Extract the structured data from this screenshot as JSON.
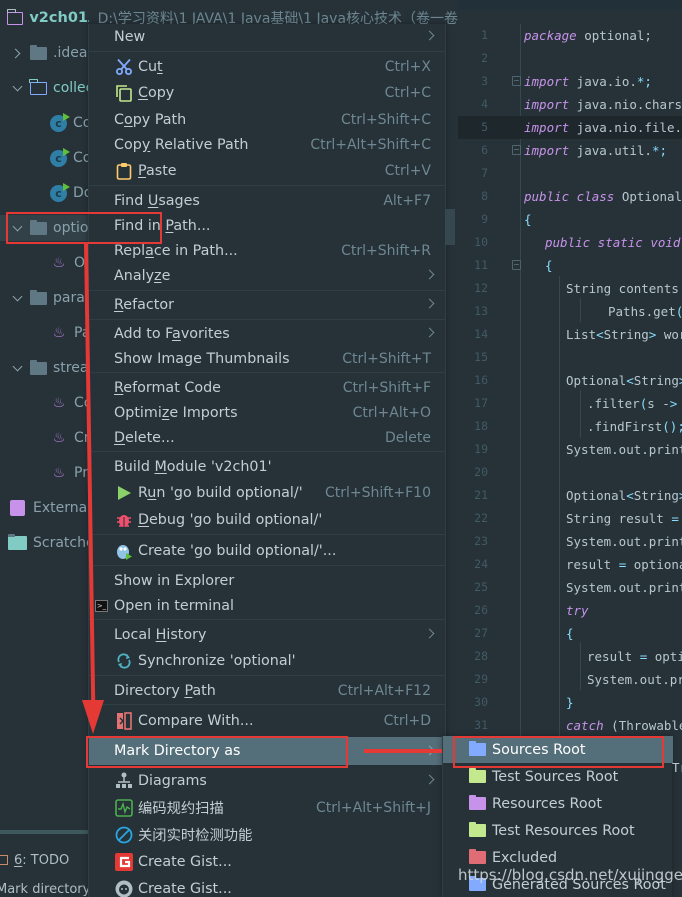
{
  "header": {
    "project_name": "v2ch01",
    "project_path": "D:\\学习资料\\1 JAVA\\1 Java基础\\1 Java核心技术（卷一卷"
  },
  "tree": {
    "items": [
      {
        "label": ".idea",
        "type": "folder",
        "expanded": false
      },
      {
        "label": "collec",
        "type": "folder-outline",
        "expanded": true
      },
      {
        "label": "Co",
        "type": "class"
      },
      {
        "label": "Co",
        "type": "class"
      },
      {
        "label": "Do",
        "type": "class"
      },
      {
        "label": "optio",
        "type": "folder",
        "expanded": true,
        "selected": true
      },
      {
        "label": "Op",
        "type": "java"
      },
      {
        "label": "paral",
        "type": "folder",
        "expanded": true
      },
      {
        "label": "Pa",
        "type": "java"
      },
      {
        "label": "strea",
        "type": "folder",
        "expanded": true
      },
      {
        "label": "Co",
        "type": "java"
      },
      {
        "label": "Cr",
        "type": "java"
      },
      {
        "label": "Pr",
        "type": "java"
      },
      {
        "label": "External",
        "type": "external-libraries"
      },
      {
        "label": "Scratche",
        "type": "scratches"
      }
    ],
    "todo_label_prefix": "6",
    "todo_label": ": TODO",
    "status_tip": "Mark directory"
  },
  "menu": {
    "items": [
      {
        "label": "New",
        "submenu": true
      },
      {
        "label": "Cut",
        "shortcut": "Ctrl+X",
        "icon": "scissors-icon"
      },
      {
        "label": "Copy",
        "shortcut": "Ctrl+C",
        "icon": "copy-icon"
      },
      {
        "label": "Copy Path",
        "shortcut": "Ctrl+Shift+C"
      },
      {
        "label": "Copy Relative Path",
        "shortcut": "Ctrl+Alt+Shift+C"
      },
      {
        "label": "Paste",
        "shortcut": "Ctrl+V",
        "icon": "clipboard-icon"
      },
      {
        "label": "Find Usages",
        "shortcut": "Alt+F7"
      },
      {
        "label": "Find in Path...",
        "shortcut": ""
      },
      {
        "label": "Replace in Path...",
        "shortcut": "Ctrl+Shift+R"
      },
      {
        "label": "Analyze",
        "submenu": true
      },
      {
        "label": "Refactor",
        "submenu": true
      },
      {
        "label": "Add to Favorites",
        "submenu": true
      },
      {
        "label": "Show Image Thumbnails",
        "shortcut": "Ctrl+Shift+T"
      },
      {
        "label": "Reformat Code",
        "shortcut": "Ctrl+Shift+F"
      },
      {
        "label": "Optimize Imports",
        "shortcut": "Ctrl+Alt+O"
      },
      {
        "label": "Delete...",
        "shortcut": "Delete"
      },
      {
        "label": "Build Module 'v2ch01'",
        "shortcut": ""
      },
      {
        "label": "Run 'go build optional/'",
        "shortcut": "Ctrl+Shift+F10",
        "icon": "run-icon"
      },
      {
        "label": "Debug 'go build optional/'",
        "shortcut": "",
        "icon": "debug-icon"
      },
      {
        "label": "Create 'go build optional/'...",
        "shortcut": "",
        "icon": "gopher-icon"
      },
      {
        "label": "Show in Explorer",
        "shortcut": ""
      },
      {
        "label": "Open in terminal",
        "shortcut": "",
        "icon": "terminal-icon"
      },
      {
        "label": "Local History",
        "submenu": true
      },
      {
        "label": "Synchronize 'optional'",
        "shortcut": "",
        "icon": "sync-icon"
      },
      {
        "label": "Directory Path",
        "shortcut": "Ctrl+Alt+F12"
      },
      {
        "label": "Compare With...",
        "shortcut": "Ctrl+D",
        "icon": "compare-icon"
      },
      {
        "label": "Mark Directory as",
        "submenu": true,
        "highlighted": true
      },
      {
        "label": "Diagrams",
        "submenu": true,
        "icon": "diagram-icon"
      },
      {
        "label": "编码规约扫描",
        "shortcut": "Ctrl+Alt+Shift+J",
        "icon": "scan-icon"
      },
      {
        "label": "关闭实时检测功能",
        "shortcut": "",
        "icon": "disable-icon"
      },
      {
        "label": "Create Gist...",
        "shortcut": "",
        "icon": "gitee-icon"
      },
      {
        "label": "Create Gist...",
        "shortcut": "",
        "icon": "github-icon"
      }
    ]
  },
  "submenu": {
    "items": [
      {
        "label": "Sources Root",
        "color": "#82aaff",
        "highlighted": true
      },
      {
        "label": "Test Sources Root",
        "color": "#c3e88d"
      },
      {
        "label": "Resources Root",
        "color": "#c792ea"
      },
      {
        "label": "Test Resources Root",
        "color": "#c3e88d"
      },
      {
        "label": "Excluded",
        "color": "#e06c75"
      },
      {
        "label": "Generated Sources Root",
        "color": "#82aaff"
      }
    ]
  },
  "editor": {
    "lines": [
      {
        "n": "1",
        "indent": 0
      },
      {
        "n": "2",
        "indent": 0
      },
      {
        "n": "3",
        "indent": 0
      },
      {
        "n": "4",
        "indent": 0
      },
      {
        "n": "5",
        "indent": 0
      },
      {
        "n": "6",
        "indent": 0
      },
      {
        "n": "7",
        "indent": 0
      },
      {
        "n": "8",
        "indent": 0
      },
      {
        "n": "9",
        "indent": 0
      },
      {
        "n": "10",
        "indent": 1
      },
      {
        "n": "11",
        "indent": 1
      },
      {
        "n": "12",
        "indent": 2
      },
      {
        "n": "13",
        "indent": 4
      },
      {
        "n": "14",
        "indent": 2
      },
      {
        "n": "15",
        "indent": 0
      },
      {
        "n": "16",
        "indent": 2
      },
      {
        "n": "17",
        "indent": 3
      },
      {
        "n": "18",
        "indent": 3
      },
      {
        "n": "19",
        "indent": 2
      },
      {
        "n": "20",
        "indent": 0
      },
      {
        "n": "21",
        "indent": 2
      },
      {
        "n": "22",
        "indent": 2
      },
      {
        "n": "23",
        "indent": 2
      },
      {
        "n": "24",
        "indent": 2
      },
      {
        "n": "25",
        "indent": 2
      },
      {
        "n": "26",
        "indent": 2
      },
      {
        "n": "27",
        "indent": 2
      },
      {
        "n": "28",
        "indent": 3
      },
      {
        "n": "29",
        "indent": 3
      },
      {
        "n": "30",
        "indent": 2
      },
      {
        "n": "31",
        "indent": 2
      }
    ],
    "code": {
      "l1": [
        "package",
        " optional;"
      ],
      "l3": [
        "import",
        " java.io.",
        "*",
        ";"
      ],
      "l4": [
        "import",
        " java.nio.charset"
      ],
      "l5": [
        "import",
        " java.nio.file.",
        "*",
        ";"
      ],
      "l6": [
        "import",
        " java.util.",
        "*",
        ";"
      ],
      "l8": [
        "public class",
        " OptionalTe"
      ],
      "l9": "{",
      "l10": "public static void",
      "l11": "{",
      "l12": "String contents =",
      "l13": "Paths.get('",
      "l14": "List<String> word",
      "l16": "Optional<String>",
      "l17": ".filter(s -> s",
      "l18": ".findFirst();",
      "l19": "System.out.printl",
      "l21": "Optional<String>",
      "l22": "String result = o",
      "l23": "System.out.printl",
      "l24": "result = optional",
      "l25": "System.out.printl",
      "l26": "try",
      "l27": "{",
      "l28": "result = optio",
      "l29": "System.out.pri",
      "l30": "}",
      "l31": [
        "catch",
        " (Throwable"
      ]
    },
    "partial_right_text": "Tr"
  },
  "watermark": "https://blog.csdn.net/xujinggen",
  "colors": {
    "background": "#263238",
    "highlight": "#546e7a",
    "annotation_red": "#e53935",
    "keyword": "#c792ea",
    "project_name": "#80cbc4"
  }
}
